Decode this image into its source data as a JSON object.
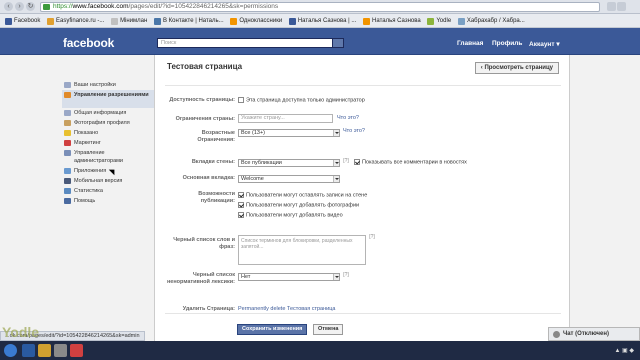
{
  "browser": {
    "url_scheme": "https://",
    "url_host": "www.facebook.com",
    "url_path": "/pages/edit/?id=105422846214265&sk=permissions",
    "bookmarks": [
      "Facebook",
      "Easyfinance.ru -...",
      "Мінимлан",
      "В Контакте | Наталь...",
      "Одноклассники",
      "Наталья Сазнова | ...",
      "Наталья Сазнова",
      "Yodle",
      "Хабрахабр / Хабра..."
    ],
    "status_url": "...ok.com/pages/edit/?id=105422846214265&sk=admin"
  },
  "header": {
    "logo": "facebook",
    "search_placeholder": "Поиск",
    "nav": [
      "Главная",
      "Профиль",
      "Аккаунт ▾"
    ]
  },
  "sidebar": {
    "items": [
      {
        "label": "Ваши настройки",
        "icon": "settings-icon"
      },
      {
        "label": "Управление разрешениями",
        "icon": "permissions-icon",
        "active": true
      },
      {
        "label": "Общая информация",
        "icon": "info-icon"
      },
      {
        "label": "Фотография профиля",
        "icon": "photo-icon"
      },
      {
        "label": "Показано",
        "icon": "featured-icon"
      },
      {
        "label": "Маркетинг",
        "icon": "marketing-icon"
      },
      {
        "label": "Управление администраторами",
        "icon": "admins-icon"
      },
      {
        "label": "Приложения",
        "icon": "apps-icon"
      },
      {
        "label": "Мобильная версия",
        "icon": "mobile-icon"
      },
      {
        "label": "Статистика",
        "icon": "stats-icon"
      },
      {
        "label": "Помощь",
        "icon": "help-icon"
      }
    ]
  },
  "main": {
    "title": "Тестовая страница",
    "view_button": "‹ Просмотреть страницу",
    "access": {
      "label": "Доступность страницы:",
      "option": "Эта страница доступна только администратор",
      "checked": false
    },
    "country": {
      "label": "Ограничения страны:",
      "placeholder": "Укажите страну...",
      "help": "Что это?"
    },
    "age": {
      "label": "Возрастные Ограничения:",
      "value": "Все (13+)",
      "help": "Что это?"
    },
    "wall_tab": {
      "label": "Вкладки стены:",
      "value": "Все публикации",
      "q": "[?]",
      "option": "Показывать все комментарии в новостях",
      "checked": true
    },
    "default_tab": {
      "label": "Основная вкладка:",
      "value": "Welcome"
    },
    "posting": {
      "label": "Возможности публикации:",
      "options": [
        {
          "text": "Пользователи могут оставлять записи на стене",
          "checked": true
        },
        {
          "text": "Пользователи могут добавлять фотографии",
          "checked": true
        },
        {
          "text": "Пользователи могут добавлять видео",
          "checked": true
        }
      ]
    },
    "moderation": {
      "label": "Черный список слов и фраз:",
      "placeholder": "Список терминов для блокировки, разделенных запятой...",
      "q": "[?]"
    },
    "profanity": {
      "label": "Черный список ненормативной лексики:",
      "value": "Нет",
      "q": "[?]"
    },
    "delete": {
      "label": "Удалить Страница:",
      "link": "Permanently delete Тестовая страница"
    },
    "save_button": "Сохранить изменения",
    "cancel_button": "Отмена"
  },
  "chat": {
    "label": "Чат (Отключен)"
  },
  "watermark": "Yodle"
}
